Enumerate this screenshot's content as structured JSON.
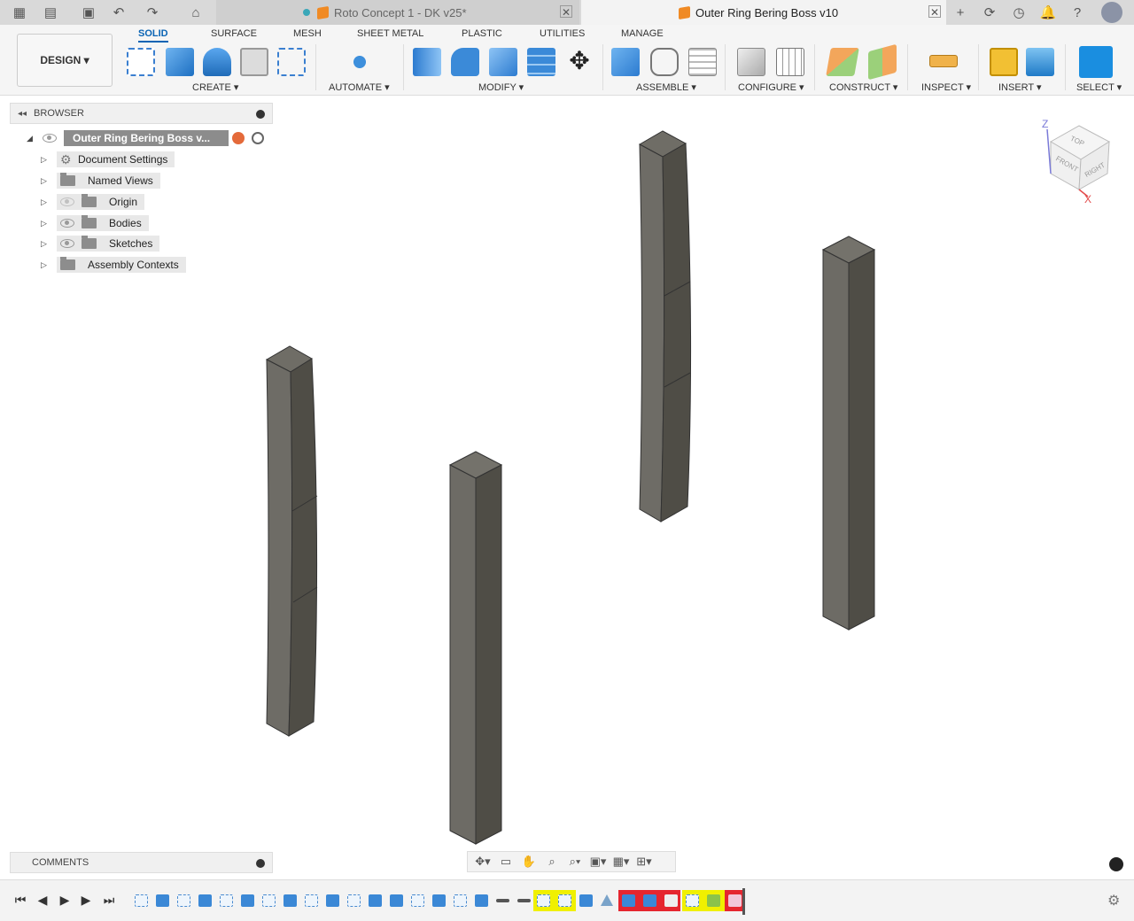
{
  "tabs": [
    {
      "label": "Roto Concept 1 - DK v25*"
    },
    {
      "label": "Outer Ring Bering Boss v10"
    }
  ],
  "ribbon": {
    "workspace": "DESIGN",
    "tabs": [
      "SOLID",
      "SURFACE",
      "MESH",
      "SHEET METAL",
      "PLASTIC",
      "UTILITIES",
      "MANAGE"
    ],
    "groups": [
      "CREATE",
      "AUTOMATE",
      "MODIFY",
      "ASSEMBLE",
      "CONFIGURE",
      "CONSTRUCT",
      "INSPECT",
      "INSERT",
      "SELECT"
    ]
  },
  "browser": {
    "title": "BROWSER",
    "root": "Outer Ring Bering Boss v...",
    "items": [
      "Document Settings",
      "Named Views",
      "Origin",
      "Bodies",
      "Sketches",
      "Assembly Contexts"
    ]
  },
  "comments": {
    "title": "COMMENTS"
  },
  "viewcube": {
    "top": "TOP",
    "front": "FRONT",
    "right": "RIGHT",
    "z": "Z",
    "x": "X"
  },
  "colors": {
    "accent": "#0a64b4",
    "body_dark": "#4f4d46",
    "body_light": "#6b6a64"
  }
}
